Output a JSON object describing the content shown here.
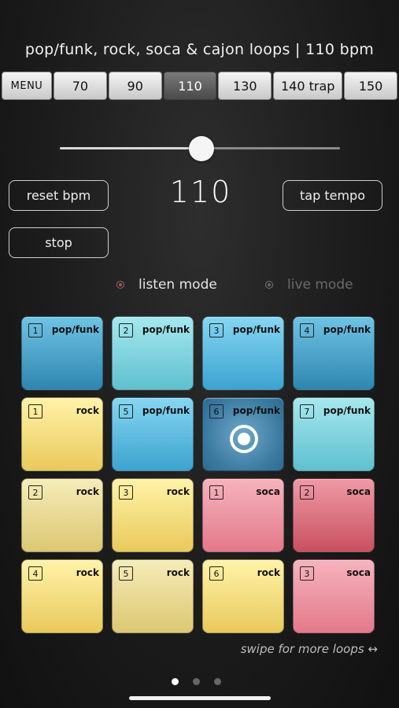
{
  "header": {
    "title": "pop/funk, rock, soca & cajon loops | 110 bpm"
  },
  "tempo_bar": {
    "menu_label": "MENU",
    "options": [
      "70",
      "90",
      "110",
      "130",
      "140 trap",
      "150"
    ],
    "selected": "110"
  },
  "slider": {
    "value_fraction": 0.505
  },
  "controls": {
    "reset_label": "reset bpm",
    "bpm_value": "110",
    "tap_label": "tap tempo",
    "stop_label": "stop"
  },
  "modes": {
    "listen_label": "listen mode",
    "live_label": "live mode",
    "active": "listen"
  },
  "pads": [
    {
      "num": "1",
      "label": "pop/funk",
      "color": "blue-dark"
    },
    {
      "num": "2",
      "label": "pop/funk",
      "color": "blue-light"
    },
    {
      "num": "3",
      "label": "pop/funk",
      "color": "blue-mid"
    },
    {
      "num": "4",
      "label": "pop/funk",
      "color": "blue-dark"
    },
    {
      "num": "1",
      "label": "rock",
      "color": "yellow"
    },
    {
      "num": "5",
      "label": "pop/funk",
      "color": "blue-mid"
    },
    {
      "num": "6",
      "label": "pop/funk",
      "color": "blue-active",
      "playing": true
    },
    {
      "num": "7",
      "label": "pop/funk",
      "color": "blue-light"
    },
    {
      "num": "2",
      "label": "rock",
      "color": "yellow-pale"
    },
    {
      "num": "3",
      "label": "rock",
      "color": "yellow"
    },
    {
      "num": "1",
      "label": "soca",
      "color": "pink"
    },
    {
      "num": "2",
      "label": "soca",
      "color": "pink-dark"
    },
    {
      "num": "4",
      "label": "rock",
      "color": "yellow"
    },
    {
      "num": "5",
      "label": "rock",
      "color": "yellow-pale"
    },
    {
      "num": "6",
      "label": "rock",
      "color": "yellow"
    },
    {
      "num": "3",
      "label": "soca",
      "color": "pink"
    }
  ],
  "footer": {
    "hint": "swipe for more loops ↔",
    "page_count": 3,
    "current_page": 1
  }
}
